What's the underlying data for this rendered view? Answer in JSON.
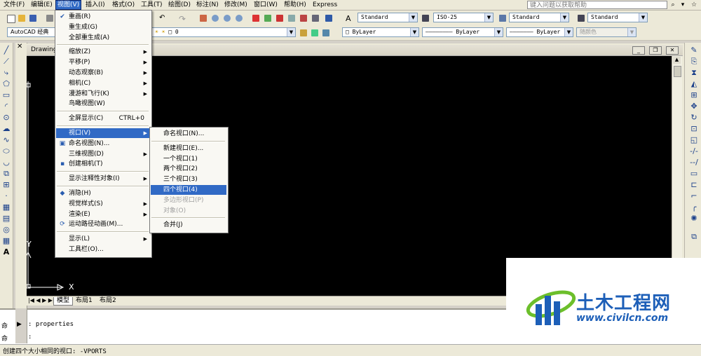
{
  "menubar": {
    "items": [
      "文件(F)",
      "编辑(E)",
      "视图(V)",
      "插入(I)",
      "格式(O)",
      "工具(T)",
      "绘图(D)",
      "标注(N)",
      "修改(M)",
      "窗口(W)",
      "帮助(H)",
      "Express"
    ],
    "active_index": 2,
    "help_placeholder": "键入问题以获取帮助"
  },
  "toolbar": {
    "workspace": "AutoCAD 经典",
    "layer_value": "0",
    "text_style": "Standard",
    "dim_style": "ISO-25",
    "table_style": "Standard",
    "multileader_style": "Standard",
    "color": "ByLayer",
    "linetype": "ByLayer",
    "lineweight": "ByLayer",
    "plotstyle": "随颜色"
  },
  "drawing": {
    "title": "Drawing",
    "tabs": [
      "模型",
      "布局1",
      "布局2"
    ],
    "active_tab": 0,
    "axis_x": "X",
    "axis_y": "Y"
  },
  "view_menu": {
    "items": [
      {
        "label": "重画(R)",
        "icon": "redraw-icon"
      },
      {
        "label": "重生成(G)"
      },
      {
        "label": "全部重生成(A)"
      },
      {
        "sep": true
      },
      {
        "label": "缩放(Z)",
        "submenu": true
      },
      {
        "label": "平移(P)",
        "submenu": true
      },
      {
        "label": "动态观察(B)",
        "submenu": true
      },
      {
        "label": "相机(C)",
        "submenu": true
      },
      {
        "label": "漫游和飞行(K)",
        "submenu": true
      },
      {
        "label": "鸟瞰视图(W)"
      },
      {
        "sep": true
      },
      {
        "label": "全屏显示(C)",
        "shortcut": "CTRL+0"
      },
      {
        "sep": true
      },
      {
        "label": "视口(V)",
        "submenu": true,
        "highlight": true
      },
      {
        "label": "命名视图(N)...",
        "icon": "named-views-icon"
      },
      {
        "label": "三维视图(D)",
        "submenu": true
      },
      {
        "label": "创建相机(T)",
        "icon": "camera-icon"
      },
      {
        "sep": true
      },
      {
        "label": "显示注释性对象(I)",
        "submenu": true
      },
      {
        "sep": true
      },
      {
        "label": "消隐(H)",
        "icon": "hide-icon"
      },
      {
        "label": "视觉样式(S)",
        "submenu": true
      },
      {
        "label": "渲染(E)",
        "submenu": true
      },
      {
        "label": "运动路径动画(M)...",
        "icon": "motion-path-icon"
      },
      {
        "sep": true
      },
      {
        "label": "显示(L)",
        "submenu": true
      },
      {
        "label": "工具栏(O)..."
      }
    ]
  },
  "viewport_submenu": {
    "items": [
      {
        "label": "命名视口(N)..."
      },
      {
        "sep": true
      },
      {
        "label": "新建视口(E)..."
      },
      {
        "label": "一个视口(1)"
      },
      {
        "label": "两个视口(2)"
      },
      {
        "label": "三个视口(3)"
      },
      {
        "label": "四个视口(4)",
        "highlight": true
      },
      {
        "label": "多边形视口(P)",
        "disabled": true
      },
      {
        "label": "对象(O)",
        "disabled": true
      },
      {
        "sep": true
      },
      {
        "label": "合并(J)"
      }
    ]
  },
  "command": {
    "line1_prefix": "命",
    "line1": ": properties",
    "line2_prefix": "命",
    "line2": ":"
  },
  "status": {
    "text": "创建四个大小相同的视口:  -VPORTS"
  },
  "watermark": {
    "title": "土木工程网",
    "url": "www.civilcn.com"
  },
  "colors": {
    "accent": "#316ac5",
    "canvas": "#000000",
    "logo_blue": "#1d5fb8",
    "logo_green": "#6cbf2b"
  }
}
